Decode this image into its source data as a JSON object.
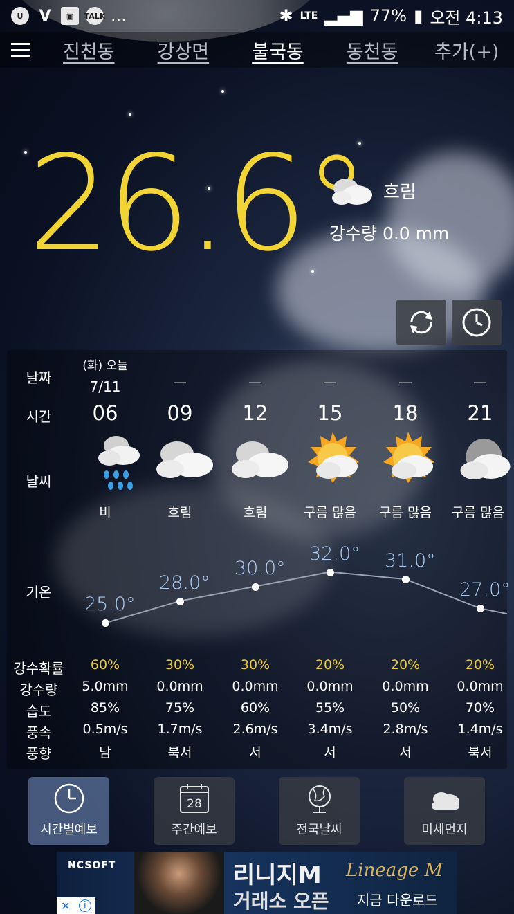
{
  "status_bar": {
    "left_icons": [
      "u-plus-icon",
      "v3-icon",
      "gallery-icon",
      "kakaotalk-icon"
    ],
    "kakao_label": "TALK",
    "more": "...",
    "network": "LTE",
    "battery": "77%",
    "time": "오전 4:13"
  },
  "tabs": [
    {
      "label": "진천동"
    },
    {
      "label": "강상면"
    },
    {
      "label": "불국동"
    },
    {
      "label": "동천동"
    },
    {
      "label": "추가(+)"
    }
  ],
  "current": {
    "temperature": "26.6°",
    "condition": "흐림",
    "precipitation": "강수량 0.0 mm"
  },
  "forecast": {
    "labels": {
      "date": "날짜",
      "time": "시간",
      "weather": "날씨",
      "temp": "기온",
      "precip_prob": "강수확률",
      "precip_amount": "강수량",
      "humidity": "습도",
      "wind_speed": "풍속",
      "wind_dir": "풍향"
    },
    "today_day": "(화) 오늘",
    "today_date": "7/11",
    "columns": [
      {
        "date": "",
        "hour": "06",
        "weather": "비",
        "temp": "25.0°",
        "temp_value": 25.0,
        "prob": "60%",
        "amount": "5.0mm",
        "humidity": "85%",
        "wind": "0.5m/s",
        "dir": "남",
        "icon": "rain-icon"
      },
      {
        "date": "—",
        "hour": "09",
        "weather": "흐림",
        "temp": "28.0°",
        "temp_value": 28.0,
        "prob": "30%",
        "amount": "0.0mm",
        "humidity": "75%",
        "wind": "1.7m/s",
        "dir": "북서",
        "icon": "cloudy-icon"
      },
      {
        "date": "—",
        "hour": "12",
        "weather": "흐림",
        "temp": "30.0°",
        "temp_value": 30.0,
        "prob": "30%",
        "amount": "0.0mm",
        "humidity": "60%",
        "wind": "2.6m/s",
        "dir": "서",
        "icon": "cloudy-icon"
      },
      {
        "date": "—",
        "hour": "15",
        "weather": "구름 많음",
        "temp": "32.0°",
        "temp_value": 32.0,
        "prob": "20%",
        "amount": "0.0mm",
        "humidity": "55%",
        "wind": "3.4m/s",
        "dir": "서",
        "icon": "sun-cloud-icon"
      },
      {
        "date": "—",
        "hour": "18",
        "weather": "구름 많음",
        "temp": "31.0°",
        "temp_value": 31.0,
        "prob": "20%",
        "amount": "0.0mm",
        "humidity": "50%",
        "wind": "2.8m/s",
        "dir": "서",
        "icon": "sun-cloud-icon"
      },
      {
        "date": "—",
        "hour": "21",
        "weather": "구름 많음",
        "temp": "27.0°",
        "temp_value": 27.0,
        "prob": "20%",
        "amount": "0.0mm",
        "humidity": "70%",
        "wind": "1.4m/s",
        "dir": "북서",
        "icon": "moon-cloud-icon"
      }
    ]
  },
  "nav": [
    {
      "label": "시간별예보",
      "icon": "clock-icon",
      "active": true
    },
    {
      "label": "주간예보",
      "icon": "calendar-icon",
      "calendar_day": "28",
      "active": false
    },
    {
      "label": "전국날씨",
      "icon": "globe-icon",
      "active": false
    },
    {
      "label": "미세먼지",
      "icon": "cloud-icon",
      "active": false
    }
  ],
  "ad": {
    "company": "NCSOFT",
    "title": "리니지M",
    "subtitle": "거래소 오픈",
    "brand": "Lineage M",
    "cta": "지금 다운로드"
  },
  "colors": {
    "temperature": "#f2d534",
    "probability": "#e8c836",
    "temp_labels": "#a9c9f0"
  }
}
